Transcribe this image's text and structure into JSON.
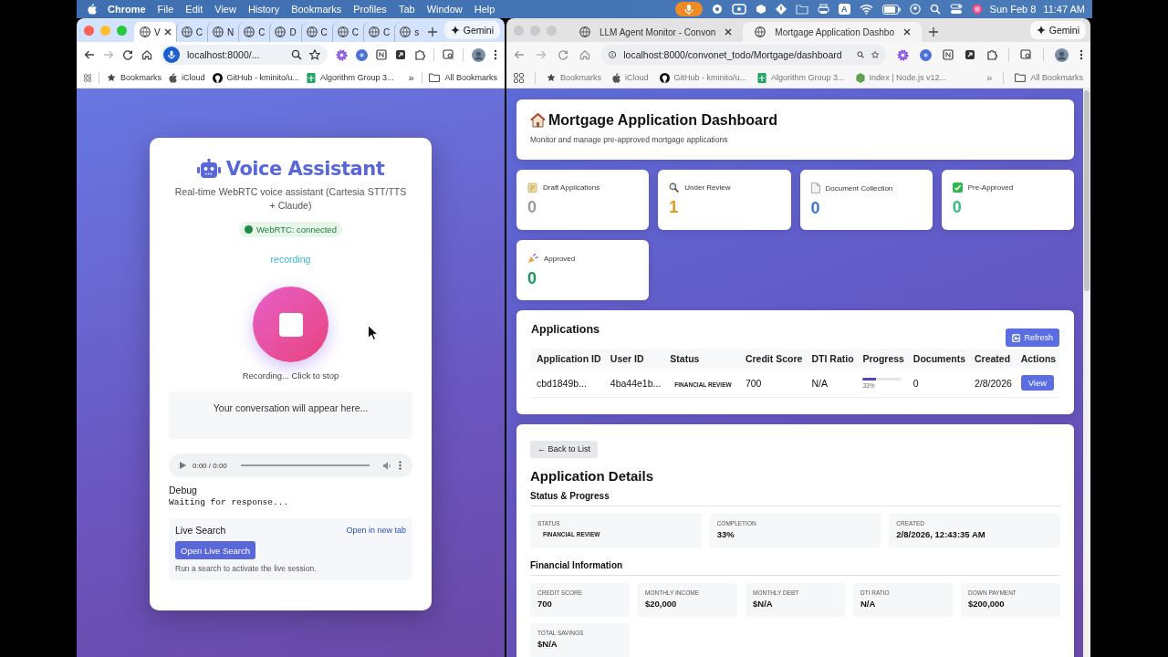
{
  "menu_bar": {
    "app": "Chrome",
    "menus": [
      "File",
      "Edit",
      "View",
      "History",
      "Bookmarks",
      "Profiles",
      "Tab",
      "Window",
      "Help"
    ],
    "input_source": "A",
    "date": "Sun Feb 8",
    "time": "11:47 AM"
  },
  "browsers": [
    {
      "focused": true,
      "tabs": [
        {
          "label": "V",
          "selected": true,
          "closable": true
        },
        {
          "label": "C",
          "selected": false,
          "closable": false
        },
        {
          "label": "N",
          "selected": false,
          "closable": false
        },
        {
          "label": "C",
          "selected": false,
          "closable": false
        },
        {
          "label": "D",
          "selected": false,
          "closable": false
        },
        {
          "label": "C",
          "selected": false,
          "closable": false
        },
        {
          "label": "C",
          "selected": false,
          "closable": false
        },
        {
          "label": "C",
          "selected": false,
          "closable": false
        },
        {
          "label": "s",
          "selected": false,
          "closable": false
        }
      ],
      "gemini": "Gemini",
      "address": {
        "kind": "microphone",
        "text": "localhost:8000/..."
      },
      "bookmarks": [
        {
          "kind": "star",
          "label": "Bookmarks"
        },
        {
          "kind": "apple",
          "label": "iCloud"
        },
        {
          "kind": "github",
          "label": "GitHub - kminito/u..."
        },
        {
          "kind": "sheet",
          "label": "Algorithm Group 3..."
        }
      ],
      "more": "»",
      "all_bookmarks": "All Bookmarks",
      "page": {
        "kind": "voice_assistant",
        "title": "Voice Assistant",
        "subtitle": "Real-time WebRTC voice assistant (Cartesia STT/TTS + Claude)",
        "connection": {
          "label": "WebRTC: connected",
          "connected": true
        },
        "state": "recording",
        "record_button": {
          "recording": true,
          "caption": "Recording... Click to stop"
        },
        "conversation_placeholder": "Your conversation will appear here...",
        "audio": {
          "time": "0:00 / 0:00"
        },
        "debug": {
          "title": "Debug",
          "text": "Waiting for response..."
        },
        "live_search": {
          "title": "Live Search",
          "link": "Open in new tab",
          "button": "Open Live Search",
          "hint": "Run a search to activate the live session."
        }
      }
    },
    {
      "focused": false,
      "tabs": [
        {
          "label": "LLM Agent Monitor - Convon",
          "selected": false,
          "closable": true
        },
        {
          "label": "Mortgage Application Dashbo",
          "selected": true,
          "closable": true
        }
      ],
      "gemini": "Gemini",
      "address": {
        "kind": "info",
        "text": "localhost:8000/convonet_todo/Mortgage/dashboard"
      },
      "bookmarks": [
        {
          "kind": "star",
          "label": "Bookmarks"
        },
        {
          "kind": "apple",
          "label": "iCloud"
        },
        {
          "kind": "github",
          "label": "GitHub - kminito/u..."
        },
        {
          "kind": "sheet",
          "label": "Algorithm Group 3..."
        },
        {
          "kind": "hexagon",
          "label": "Index | Node.js v12..."
        }
      ],
      "more": "»",
      "all_bookmarks": "All Bookmarks",
      "page": {
        "kind": "mortgage_dashboard",
        "title": "Mortgage Application Dashboard",
        "subtitle": "Monitor and manage pre-approved mortgage applications",
        "stats": [
          {
            "kind": "draft",
            "label": "Draft Applications",
            "value": "0",
            "color": "#9a9a9a"
          },
          {
            "kind": "review",
            "label": "Under Review",
            "value": "1",
            "color": "#e09a1c"
          },
          {
            "kind": "documents",
            "label": "Document Collection",
            "value": "0",
            "color": "#3a78d0"
          },
          {
            "kind": "pre_approved",
            "label": "Pre-Approved",
            "value": "0",
            "color": "#2fbf80"
          },
          {
            "kind": "approved",
            "label": "Approved",
            "value": "0",
            "color": "#17995c"
          }
        ],
        "applications": {
          "title": "Applications",
          "refresh": "Refresh",
          "columns": [
            "Application ID",
            "User ID",
            "Status",
            "Credit Score",
            "DTI Ratio",
            "Progress",
            "Documents",
            "Created",
            "Actions"
          ],
          "rows": [
            {
              "application_id": "cbd1849b...",
              "user_id": "4ba44e1b...",
              "status": "FINANCIAL REVIEW",
              "credit_score": "700",
              "dti_ratio": "N/A",
              "progress": {
                "level": 0.33,
                "reading": "33%"
              },
              "documents": "0",
              "created": "2/8/2026",
              "action": "View"
            }
          ]
        },
        "details": {
          "back": "← Back to List",
          "title": "Application Details",
          "sections": [
            {
              "kind": "status",
              "title": "Status & Progress",
              "fields": [
                {
                  "kind": "badge",
                  "label": "STATUS",
                  "value": "FINANCIAL REVIEW"
                },
                {
                  "kind": "text",
                  "label": "COMPLETION",
                  "value": "33%"
                },
                {
                  "kind": "text",
                  "label": "CREATED",
                  "value": "2/8/2026, 12:43:35 AM"
                }
              ]
            },
            {
              "kind": "financial",
              "title": "Financial Information",
              "fields": [
                {
                  "kind": "text",
                  "label": "CREDIT SCORE",
                  "value": "700"
                },
                {
                  "kind": "text",
                  "label": "MONTHLY INCOME",
                  "value": "$20,000"
                },
                {
                  "kind": "text",
                  "label": "MONTHLY DEBT",
                  "value": "$N/A"
                },
                {
                  "kind": "text",
                  "label": "DTI RATIO",
                  "value": "N/A"
                },
                {
                  "kind": "text",
                  "label": "DOWN PAYMENT",
                  "value": "$200,000"
                },
                {
                  "kind": "text",
                  "label": "TOTAL SAVINGS",
                  "value": "$N/A"
                }
              ]
            }
          ]
        }
      }
    }
  ]
}
